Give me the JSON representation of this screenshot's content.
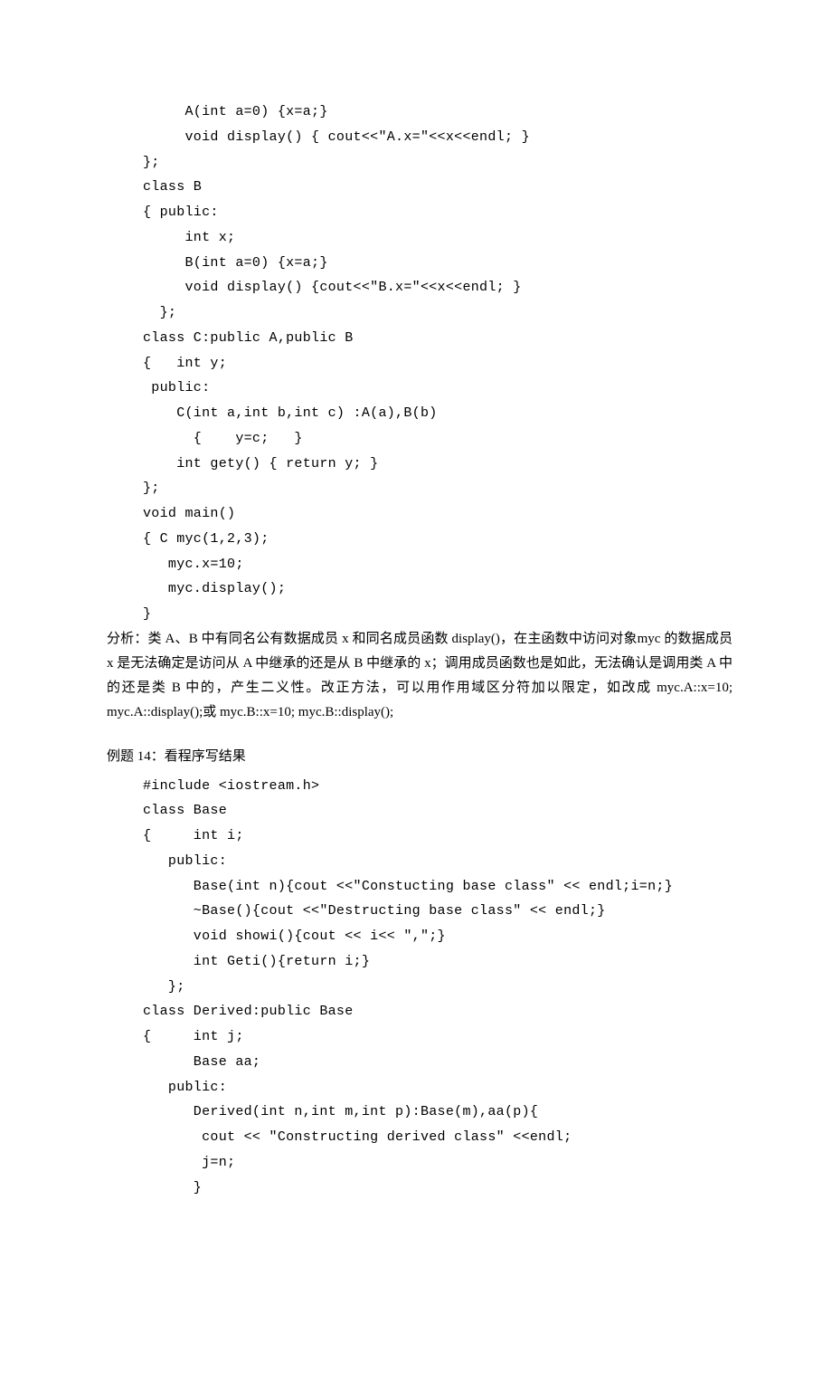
{
  "code1": "     A(int a=0) {x=a;}\n     void display() { cout<<\"A.x=\"<<x<<endl; }\n};\nclass B\n{ public:\n     int x;\n     B(int a=0) {x=a;}\n     void display() {cout<<\"B.x=\"<<x<<endl; }\n  };\nclass C:public A,public B\n{   int y;\n public:\n    C(int a,int b,int c) :A(a),B(b)\n      {    y=c;   }\n    int gety() { return y; }\n};\nvoid main()\n{ C myc(1,2,3);\n   myc.x=10;\n   myc.display();\n}",
  "analysis": "分析：类 A、B 中有同名公有数据成员 x 和同名成员函数 display()，在主函数中访问对象myc 的数据成员 x 是无法确定是访问从 A 中继承的还是从 B 中继承的 x；调用成员函数也是如此，无法确认是调用类 A 中的还是类 B 中的，产生二义性。改正方法，可以用作用域区分符加以限定，如改成 myc.A::x=10; myc.A::display();或 myc.B::x=10; myc.B::display();",
  "heading2": "例题 14：看程序写结果",
  "code2": "#include <iostream.h>\nclass Base\n{     int i;\n   public:\n      Base(int n){cout <<\"Constucting base class\" << endl;i=n;}\n      ~Base(){cout <<\"Destructing base class\" << endl;}\n      void showi(){cout << i<< \",\";}\n      int Geti(){return i;}\n   };\nclass Derived:public Base\n{     int j;\n      Base aa;\n   public:\n      Derived(int n,int m,int p):Base(m),aa(p){\n       cout << \"Constructing derived class\" <<endl;\n       j=n;\n      }"
}
